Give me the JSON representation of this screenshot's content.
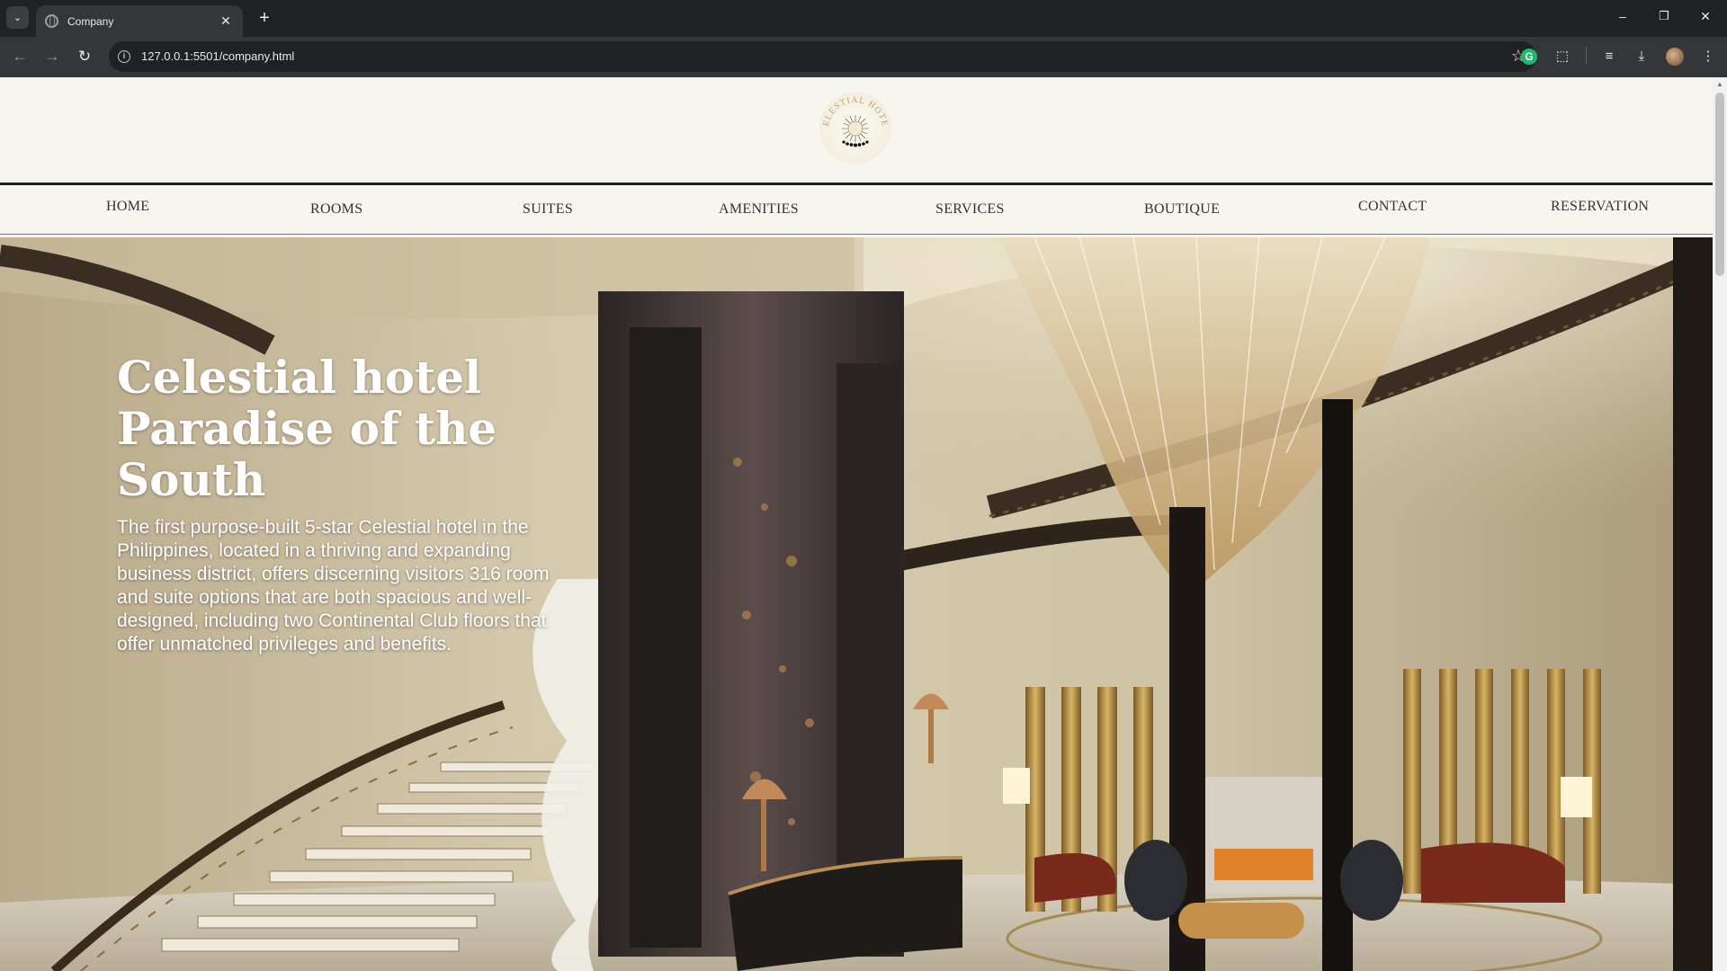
{
  "browser": {
    "tab_title": "Company",
    "url": "127.0.0.1:5501/company.html",
    "icons": [
      "tab-search-icon",
      "favicon-icon",
      "close-icon",
      "plus-icon",
      "back-icon",
      "forward-icon",
      "reload-icon",
      "info-icon",
      "star-icon",
      "grammarly-icon",
      "extensions-icon",
      "media-icon",
      "download-icon",
      "profile-avatar",
      "menu-icon",
      "minimize-icon",
      "restore-icon",
      "window-close-icon"
    ]
  },
  "header": {
    "logo_text": "CELESTIAL HOTEL"
  },
  "nav": {
    "items": [
      "HOME",
      "ROOMS",
      "SUITES",
      "AMENITIES",
      "SERVICES",
      "BOUTIQUE",
      "CONTACT",
      "RESERVATION"
    ]
  },
  "hero": {
    "title_line1": "Celestial hotel",
    "title_line2": "Paradise of the",
    "title_line3": "South",
    "body": "The first purpose-built 5-star Celestial hotel in the Philippines, located in a thriving and expanding business district, offers discerning visitors 316 room and suite options that are both spacious and well-designed, including two Continental Club floors that offer unmatched privileges and benefits."
  },
  "colors": {
    "page_bg": "#f7f5ef",
    "nav_text": "#333333",
    "hero_text": "#ffffff",
    "chrome_dark": "#202124",
    "chrome_mid": "#35363a",
    "logo_gold": "#c2a26a"
  }
}
